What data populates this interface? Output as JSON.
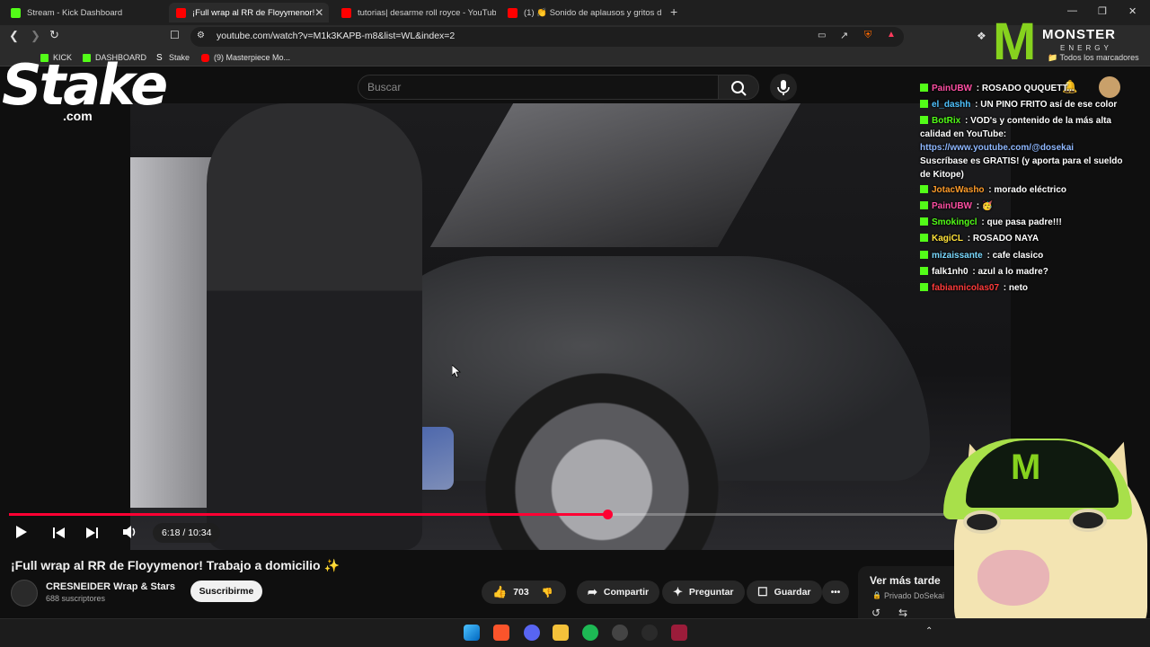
{
  "browser": {
    "tabs": [
      {
        "label": "Stream - Kick Dashboard",
        "favicon": "kick-icon"
      },
      {
        "label": "¡Full wrap al RR de Floyymenor!",
        "favicon": "youtube-icon",
        "active": true,
        "close": "✕"
      },
      {
        "label": "tutorias| desarme roll royce - YouTub",
        "favicon": "youtube-icon"
      },
      {
        "label": "(1) 👏 Sonido de aplausos y gritos d",
        "favicon": "youtube-icon"
      }
    ],
    "new_tab": "+",
    "window_controls": {
      "minimize": "—",
      "restore": "❐",
      "close": "✕"
    },
    "url": "youtube.com/watch?v=M1k3KAPB-m8&list=WL&index=2",
    "bookmarks": [
      {
        "label": "KICK",
        "icon": "kick-icon"
      },
      {
        "label": "DASHBOARD",
        "icon": "kick-icon"
      },
      {
        "label": "Stake",
        "icon": "stake-icon"
      },
      {
        "label": "(9) Masterpiece Mo...",
        "icon": "youtube-icon"
      }
    ],
    "all_bookmarks": "Todos los marcadores"
  },
  "youtube": {
    "search_placeholder": "Buscar",
    "player": {
      "time": "6:18 / 10:34",
      "progress": 0.6
    },
    "video": {
      "title": "¡Full wrap al RR de Floyymenor! Trabajo a domicilio ✨",
      "channel": "CRESNEIDER Wrap & Stars",
      "subscribers": "688 suscriptores",
      "subscribe_label": "Suscribirme",
      "likes": "703",
      "share_label": "Compartir",
      "ask_label": "Preguntar",
      "save_label": "Guardar",
      "more_label": "•••"
    },
    "playlist": {
      "title": "Ver más tarde",
      "subtitle": "Privado DoSekai"
    }
  },
  "overlays": {
    "stake_logo": "Stake",
    "stake_com": ".com",
    "monster_brand": "MONSTER",
    "monster_energy": "ENERGY",
    "monster_claw": "M"
  },
  "chat": [
    {
      "user": "PainUBW",
      "color": "#ff4fa3",
      "text": " : ROSADO QUQUETT..."
    },
    {
      "user": "el_dashh",
      "color": "#4fc3ff",
      "text": " : UN PINO FRITO así de ese color"
    },
    {
      "user": "BotRix",
      "color": "#53fc18",
      "text": " : VOD's y contenido de la más alta calidad en YouTube:"
    },
    {
      "user": "",
      "color": "#8fb8ff",
      "text": "https://www.youtube.com/@dosekai",
      "link": true
    },
    {
      "user": "",
      "color": "#ffffff",
      "text": "Suscríbase es GRATIS! (y aporta para el sueldo de Kitope)"
    },
    {
      "user": "JotacWasho",
      "color": "#ff9c2a",
      "text": " : morado eléctrico"
    },
    {
      "user": "PainUBW",
      "color": "#ff4fa3",
      "text": " : 🥳"
    },
    {
      "user": "Smokingcl",
      "color": "#53fc18",
      "text": " : que pasa padre!!!"
    },
    {
      "user": "KagiCL",
      "color": "#ffe23a",
      "text": " : ROSADO NAYA"
    },
    {
      "user": "mizaissante",
      "color": "#7ad9ff",
      "text": " : cafe clasico"
    },
    {
      "user": "falk1nh0",
      "color": "#ffffff",
      "text": " : azul a lo madre?"
    },
    {
      "user": "fabiannicolas07",
      "color": "#ff3b3b",
      "text": " : neto"
    }
  ],
  "colors": {
    "accent_red": "#ff0033",
    "kick_green": "#53fc18",
    "monster_green": "#86d21e"
  }
}
